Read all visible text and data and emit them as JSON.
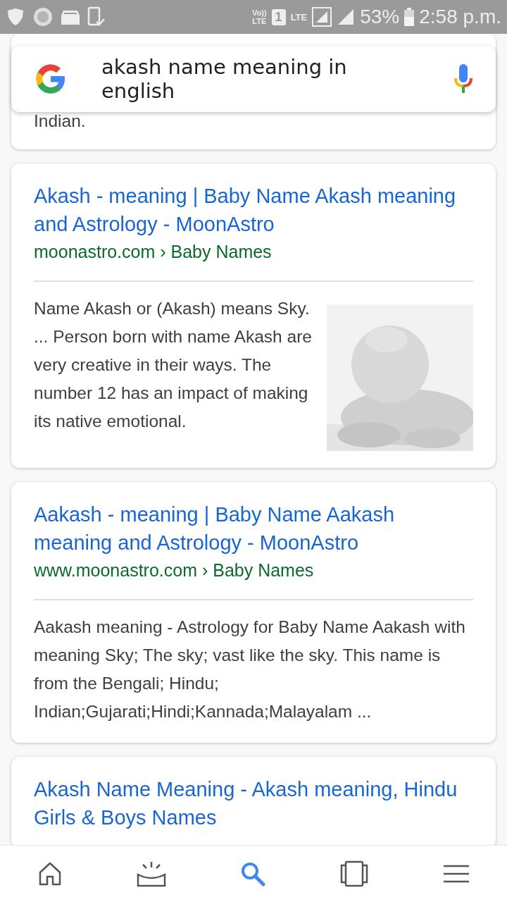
{
  "status_bar": {
    "volte_top": "Vo))",
    "volte_bottom": "LTE",
    "sim": "1",
    "network": "LTE",
    "battery": "53%",
    "time": "2:58 p.m."
  },
  "search": {
    "value": "akash name meaning in english"
  },
  "results": [
    {
      "kind": "fragment",
      "snippet": "Indian."
    },
    {
      "kind": "result",
      "title": "Akash - meaning | Baby Name Akash meaning and Astrology - MoonAstro",
      "source": "moonastro.com › Baby Names",
      "snippet": "Name Akash or (Akash) means Sky. ... Person born with name Akash are very creative in their ways. The number 12 has an impact of making its native emotional."
    },
    {
      "kind": "result",
      "title": "Aakash - meaning | Baby Name Aakash meaning and Astrology - MoonAstro",
      "source": "www.moonastro.com › Baby Names",
      "snippet": "Aakash meaning - Astrology for Baby Name Aakash with meaning Sky; The sky; vast like the sky. This name is from the Bengali; Hindu; Indian;Gujarati;Hindi;Kannada;Malayalam ..."
    },
    {
      "kind": "result",
      "title": "Akash Name Meaning - Akash meaning, Hindu Girls & Boys Names"
    }
  ],
  "nav": [
    {
      "kind": "home",
      "selected": false
    },
    {
      "kind": "updates",
      "selected": false
    },
    {
      "kind": "search",
      "selected": true
    },
    {
      "kind": "tabs",
      "selected": false
    },
    {
      "kind": "menu",
      "selected": false
    }
  ]
}
